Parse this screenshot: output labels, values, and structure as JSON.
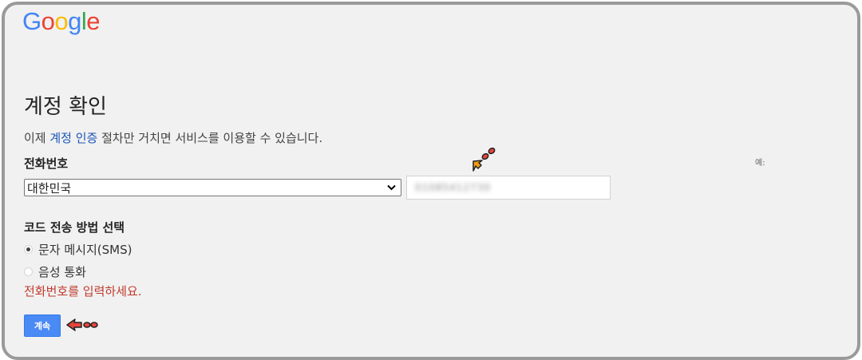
{
  "logo": {
    "letters": [
      "G",
      "o",
      "o",
      "g",
      "l",
      "e"
    ]
  },
  "page_title": "계정 확인",
  "intro": {
    "before": "이제 ",
    "link": "계정 인증",
    "after": " 절차만 거치면 서비스를 이용할 수 있습니다."
  },
  "phone_section": {
    "label": "전화번호",
    "example_label": "예:",
    "country_select": {
      "selected": "대한민국"
    },
    "phone_input": {
      "value": "01085412730"
    }
  },
  "code_method": {
    "label": "코드 전송 방법 선택",
    "options": [
      {
        "label": "문자 메시지(SMS)",
        "checked": true
      },
      {
        "label": "음성 통화",
        "checked": false
      }
    ]
  },
  "error_message": "전화번호를 입력하세요.",
  "continue_button": "계속",
  "colors": {
    "primary_button": "#4a8af4",
    "error": "#c0392b",
    "link": "#1a55b8",
    "annotation_arrow": "#f39c12"
  }
}
